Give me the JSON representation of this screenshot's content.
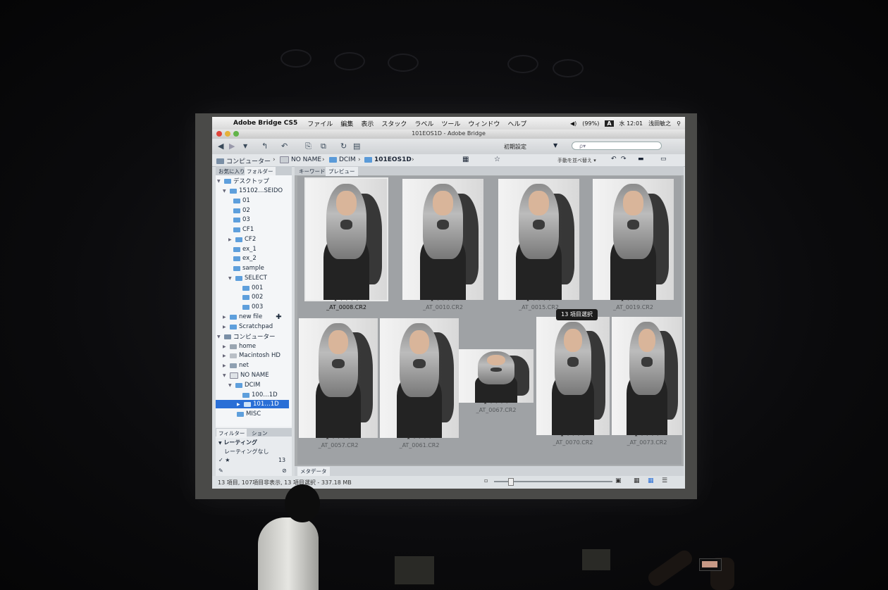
{
  "menubar": {
    "app_name": "Adobe Bridge CS5",
    "items": [
      "ファイル",
      "編集",
      "表示",
      "スタック",
      "ラベル",
      "ツール",
      "ウィンドウ",
      "ヘルプ"
    ],
    "battery": "(99%)",
    "clock": "水 12:01",
    "user": "浅田敏之",
    "input_badge": "A"
  },
  "window": {
    "title": "101EOS1D - Adobe Bridge"
  },
  "toolbar": {
    "workspace": "初期設定",
    "search_placeholder": "ρ▾",
    "sort_label": "手動を並べ替え ▾"
  },
  "path": {
    "items": [
      "コンピューター",
      "NO NAME",
      "DCIM",
      "101EOS1D"
    ]
  },
  "left_panel": {
    "tabs": [
      "お気に入り",
      "フォルダー"
    ],
    "tree": [
      {
        "label": "デスクトップ"
      },
      {
        "label": "15102…SEIDO"
      },
      {
        "label": "01"
      },
      {
        "label": "02"
      },
      {
        "label": "03"
      },
      {
        "label": "CF1"
      },
      {
        "label": "CF2"
      },
      {
        "label": "ex_1"
      },
      {
        "label": "ex_2"
      },
      {
        "label": "sample"
      },
      {
        "label": "SELECT"
      },
      {
        "label": "001"
      },
      {
        "label": "002"
      },
      {
        "label": "003"
      },
      {
        "label": "new file"
      },
      {
        "label": "Scratchpad"
      },
      {
        "label": "コンピューター"
      },
      {
        "label": "home"
      },
      {
        "label": "Macintosh HD"
      },
      {
        "label": "net"
      },
      {
        "label": "NO NAME"
      },
      {
        "label": "DCIM"
      },
      {
        "label": "100…1D"
      },
      {
        "label": "101…1D"
      },
      {
        "label": "MISC"
      }
    ],
    "filter_tabs": [
      "フィルター",
      "ション"
    ],
    "filter_heading": "レーティング",
    "filter_none": "レーティングなし",
    "filter_star": "★",
    "filter_count": "13"
  },
  "content": {
    "tabs": [
      "キーワード",
      "プレビュー"
    ],
    "tooltip": "13 項目選択",
    "thumbnails": [
      {
        "name": "_AT_0008.CR2"
      },
      {
        "name": "_AT_0010.CR2"
      },
      {
        "name": "_AT_0015.CR2"
      },
      {
        "name": "_AT_0019.CR2"
      },
      {
        "name": "_AT_0057.CR2"
      },
      {
        "name": "_AT_0061.CR2"
      },
      {
        "name": "_AT_0067.CR2"
      },
      {
        "name": "_AT_0070.CR2"
      },
      {
        "name": "_AT_0073.CR2"
      }
    ],
    "metadata_tab": "メタデータ"
  },
  "status": {
    "text": "13 項目, 107項目非表示, 13 項目選択 - 337.18 MB"
  },
  "colors": {
    "selection": "#2a6fd6",
    "folder": "#5e9fdc",
    "panel_bg": "#d8dcdf"
  }
}
